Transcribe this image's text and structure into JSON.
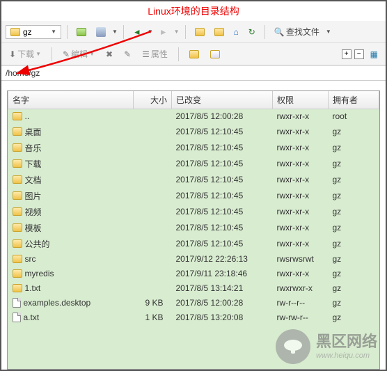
{
  "title": "Linux环境的目录结构",
  "toolbar": {
    "folder_label": "gz",
    "download": "下载",
    "edit": "编辑",
    "properties": "属性",
    "find_files": "查找文件"
  },
  "path": "/home/gz",
  "columns": {
    "name": "名字",
    "size": "大小",
    "changed": "已改变",
    "rights": "权限",
    "owner": "拥有者"
  },
  "rows": [
    {
      "icon": "up",
      "name": "..",
      "size": "",
      "changed": "2017/8/5 12:00:28",
      "rights": "rwxr-xr-x",
      "owner": "root"
    },
    {
      "icon": "folder",
      "name": "桌面",
      "size": "",
      "changed": "2017/8/5 12:10:45",
      "rights": "rwxr-xr-x",
      "owner": "gz"
    },
    {
      "icon": "folder",
      "name": "音乐",
      "size": "",
      "changed": "2017/8/5 12:10:45",
      "rights": "rwxr-xr-x",
      "owner": "gz"
    },
    {
      "icon": "folder",
      "name": "下载",
      "size": "",
      "changed": "2017/8/5 12:10:45",
      "rights": "rwxr-xr-x",
      "owner": "gz"
    },
    {
      "icon": "folder",
      "name": "文档",
      "size": "",
      "changed": "2017/8/5 12:10:45",
      "rights": "rwxr-xr-x",
      "owner": "gz"
    },
    {
      "icon": "folder",
      "name": "图片",
      "size": "",
      "changed": "2017/8/5 12:10:45",
      "rights": "rwxr-xr-x",
      "owner": "gz"
    },
    {
      "icon": "folder",
      "name": "视频",
      "size": "",
      "changed": "2017/8/5 12:10:45",
      "rights": "rwxr-xr-x",
      "owner": "gz"
    },
    {
      "icon": "folder",
      "name": "模板",
      "size": "",
      "changed": "2017/8/5 12:10:45",
      "rights": "rwxr-xr-x",
      "owner": "gz"
    },
    {
      "icon": "folder",
      "name": "公共的",
      "size": "",
      "changed": "2017/8/5 12:10:45",
      "rights": "rwxr-xr-x",
      "owner": "gz"
    },
    {
      "icon": "folder",
      "name": "src",
      "size": "",
      "changed": "2017/9/12 22:26:13",
      "rights": "rwsrwsrwt",
      "owner": "gz"
    },
    {
      "icon": "folder",
      "name": "myredis",
      "size": "",
      "changed": "2017/9/11 23:18:46",
      "rights": "rwxr-xr-x",
      "owner": "gz"
    },
    {
      "icon": "folder",
      "name": "1.txt",
      "size": "",
      "changed": "2017/8/5 13:14:21",
      "rights": "rwxrwxr-x",
      "owner": "gz"
    },
    {
      "icon": "file",
      "name": "examples.desktop",
      "size": "9 KB",
      "changed": "2017/8/5 12:00:28",
      "rights": "rw-r--r--",
      "owner": "gz"
    },
    {
      "icon": "file",
      "name": "a.txt",
      "size": "1 KB",
      "changed": "2017/8/5 13:20:08",
      "rights": "rw-rw-r--",
      "owner": "gz"
    }
  ],
  "watermark": {
    "brand": "黑区网络",
    "url": "www.heiqu.com"
  }
}
